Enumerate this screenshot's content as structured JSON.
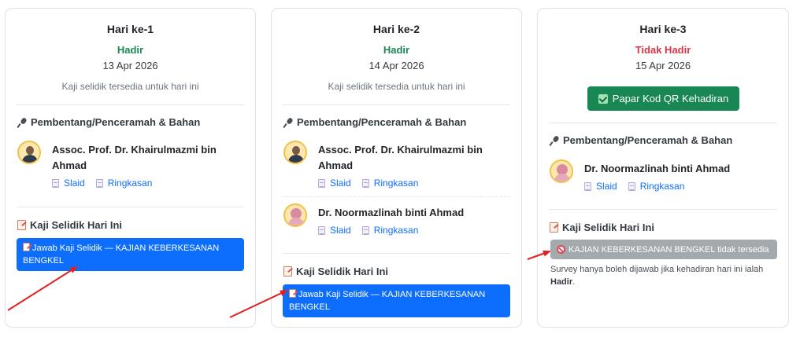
{
  "days": [
    {
      "title": "Hari ke-1",
      "status": "Hadir",
      "date": "13 Apr 2026",
      "note": "Kaji selidik tersedia untuk hari ini",
      "speakers_heading": "Pembentang/Penceramah & Bahan",
      "speakers": [
        {
          "name": "Assoc. Prof. Dr. Khairulmazmi bin Ahmad",
          "slides": "Slaid",
          "summary": "Ringkasan"
        }
      ],
      "survey_heading": "Kaji Selidik Hari Ini",
      "survey_button": "Jawab Kaji Selidik — KAJIAN KEBERKESANAN BENGKEL"
    },
    {
      "title": "Hari ke-2",
      "status": "Hadir",
      "date": "14 Apr 2026",
      "note": "Kaji selidik tersedia untuk hari ini",
      "speakers_heading": "Pembentang/Penceramah & Bahan",
      "speakers": [
        {
          "name": "Assoc. Prof. Dr. Khairulmazmi bin Ahmad",
          "slides": "Slaid",
          "summary": "Ringkasan"
        },
        {
          "name": "Dr. Noormazlinah binti Ahmad",
          "slides": "Slaid",
          "summary": "Ringkasan"
        }
      ],
      "survey_heading": "Kaji Selidik Hari Ini",
      "survey_button": "Jawab Kaji Selidik — KAJIAN KEBERKESANAN BENGKEL"
    },
    {
      "title": "Hari ke-3",
      "status": "Tidak Hadir",
      "date": "15 Apr 2026",
      "qr_button": "Papar Kod QR Kehadiran",
      "speakers_heading": "Pembentang/Penceramah & Bahan",
      "speakers": [
        {
          "name": "Dr. Noormazlinah binti Ahmad",
          "slides": "Slaid",
          "summary": "Ringkasan"
        }
      ],
      "survey_heading": "Kaji Selidik Hari Ini",
      "survey_unavailable": "KAJIAN KEBERKESANAN BENGKEL tidak tersedia",
      "hint_prefix": "Survey hanya boleh dijawab jika kehadiran hari ini ialah ",
      "hint_status": "Hadir",
      "hint_suffix": "."
    }
  ],
  "colors": {
    "present": "#198754",
    "absent": "#dc3545",
    "primary": "#0d6efd",
    "disabled": "#a4a9ae",
    "annotation_arrow": "#e02020"
  }
}
